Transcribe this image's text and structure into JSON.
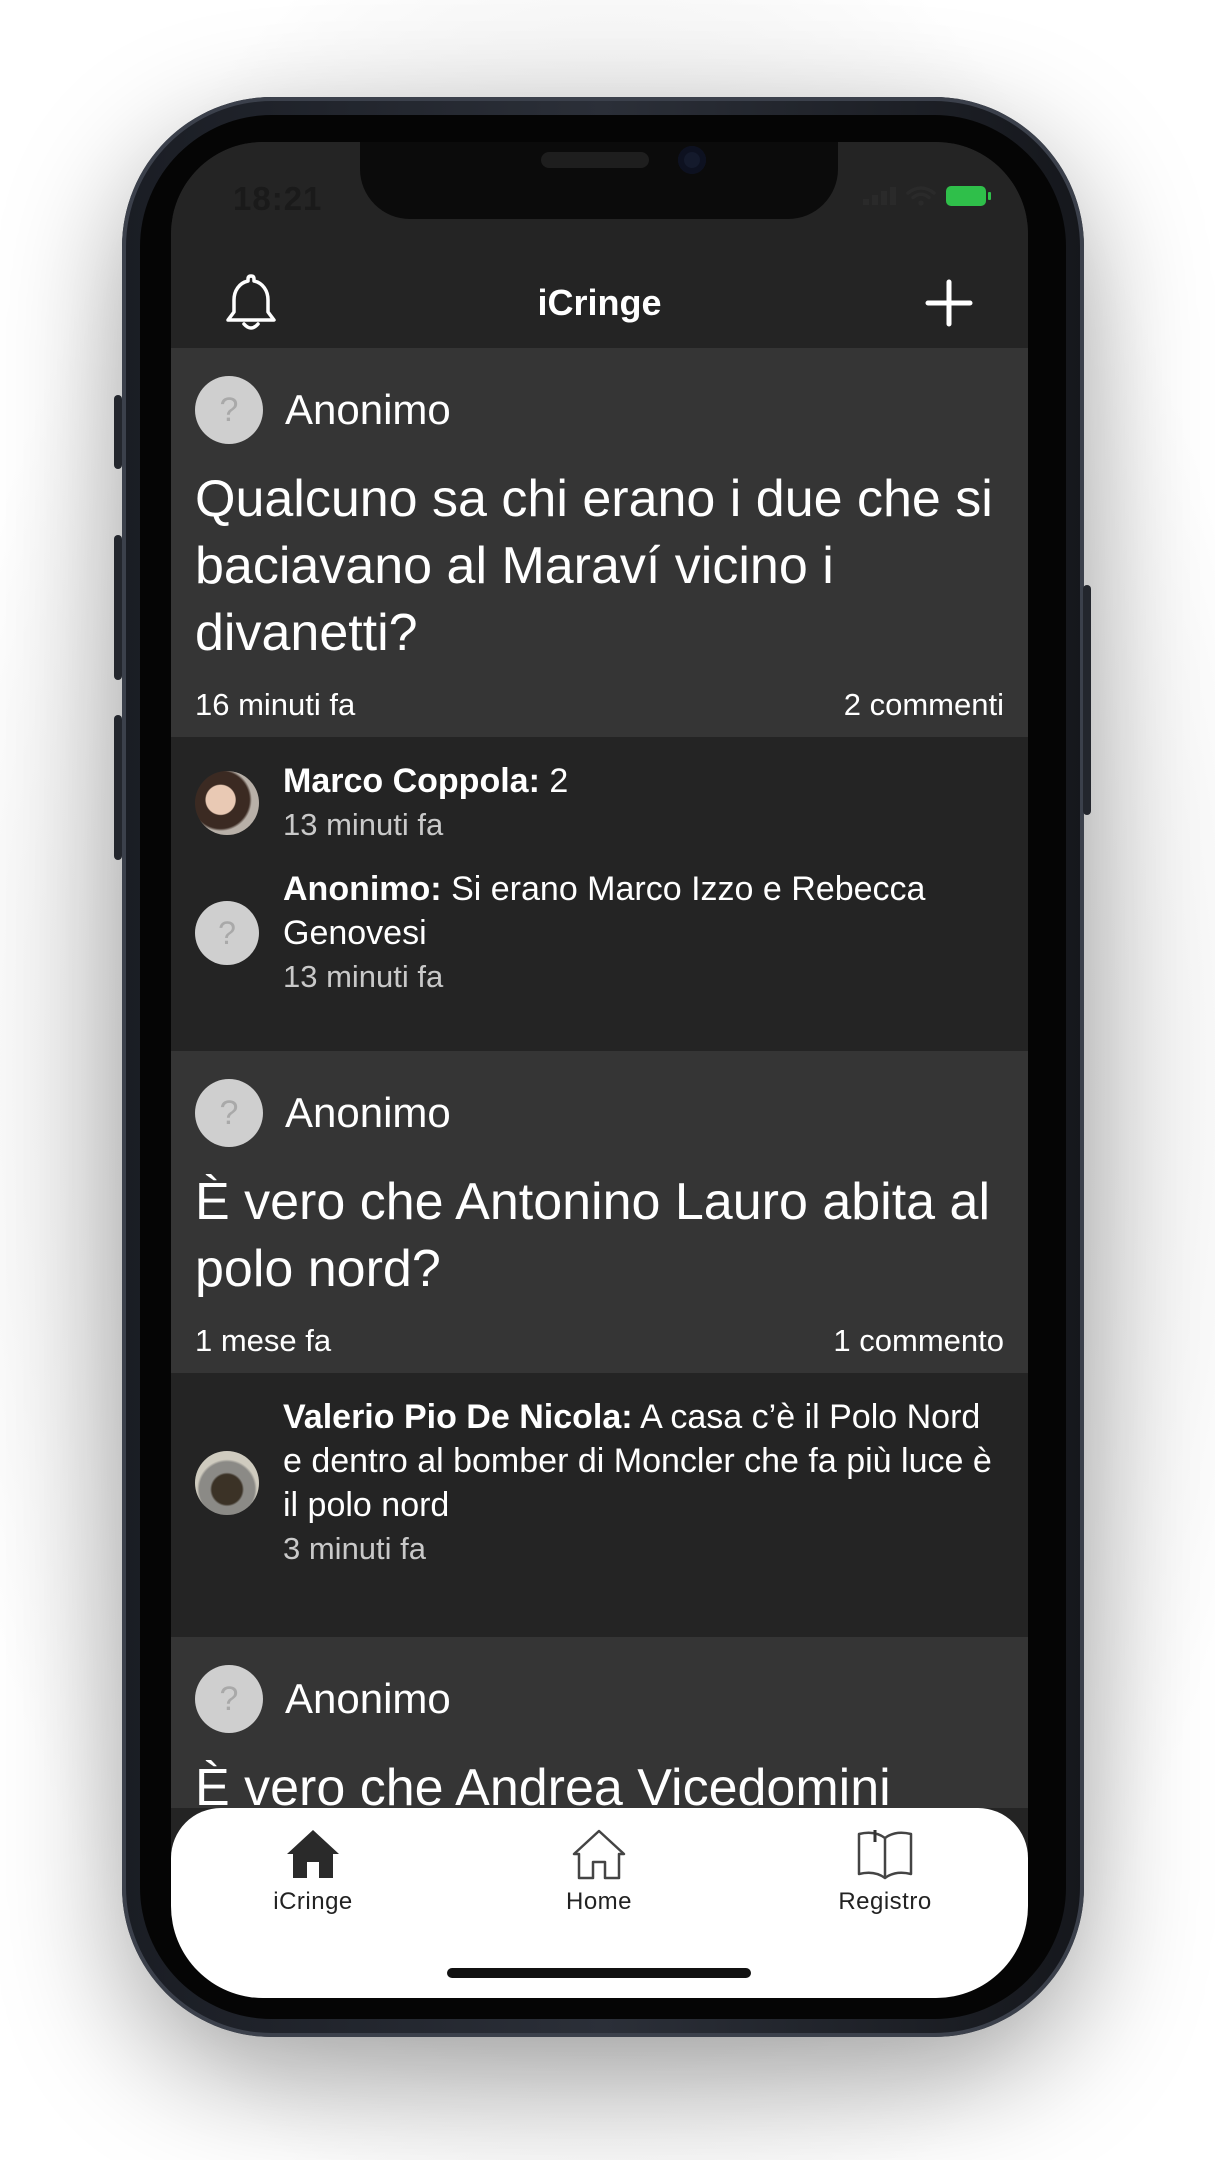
{
  "status": {
    "time": "18:21"
  },
  "nav": {
    "title": "iCringe"
  },
  "posts": [
    {
      "author": "Anonimo",
      "text": "Qualcuno sa chi erano i due che si baciavano al Maraví vicino i divanetti?",
      "time": "16 minuti fa",
      "comment_count": "2 commenti",
      "comments": [
        {
          "name": "Marco Coppola:",
          "text": "2",
          "time": "13 minuti fa"
        },
        {
          "name": "Anonimo:",
          "text": "Si erano Marco Izzo e Rebecca Genovesi",
          "time": "13 minuti fa"
        }
      ]
    },
    {
      "author": "Anonimo",
      "text": "È vero che Antonino Lauro abita al polo nord?",
      "time": "1 mese fa",
      "comment_count": "1 commento",
      "comments": [
        {
          "name": "Valerio Pio De Nicola:",
          "text": "A casa c’è il Polo Nord e dentro al bomber di Moncler che fa più luce è il polo nord",
          "time": "3 minuti fa"
        }
      ]
    },
    {
      "author": "Anonimo",
      "text": "È vero che Andrea Vicedomini"
    }
  ],
  "tabs": [
    {
      "label": "iCringe",
      "icon": "house-filled-icon"
    },
    {
      "label": "Home",
      "icon": "house-outline-icon"
    },
    {
      "label": "Registro",
      "icon": "book-icon"
    }
  ],
  "placeholder_avatar": "?"
}
